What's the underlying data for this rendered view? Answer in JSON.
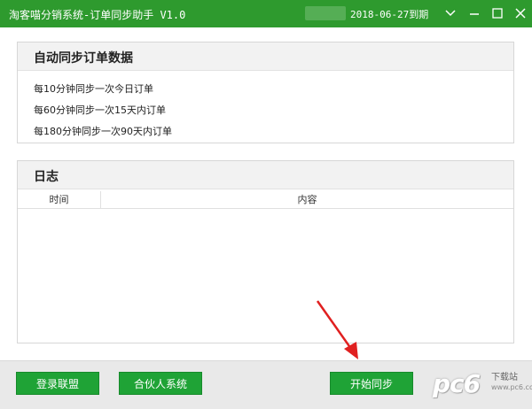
{
  "window": {
    "title": "淘客喵分销系统-订单同步助手 V1.0",
    "expiry": "2018-06-27到期"
  },
  "sync_panel": {
    "title": "自动同步订单数据",
    "lines": [
      "每10分钟同步一次今日订单",
      "每60分钟同步一次15天内订单",
      "每180分钟同步一次90天内订单"
    ]
  },
  "log_panel": {
    "title": "日志",
    "columns": [
      "时间",
      "内容"
    ]
  },
  "footer": {
    "login_label": "登录联盟",
    "partner_label": "合伙人系统",
    "start_label": "开始同步"
  },
  "watermark": {
    "logo": "pc6",
    "sub": "下载站",
    "url": "www.pc6.com"
  },
  "colors": {
    "titlebar": "#2e9a2e",
    "button": "#1fa336",
    "arrow": "#e02020"
  },
  "icons": {
    "dropdown": "chevron-down-icon",
    "minimize": "minimize-icon",
    "maximize": "maximize-icon",
    "close": "close-icon"
  }
}
